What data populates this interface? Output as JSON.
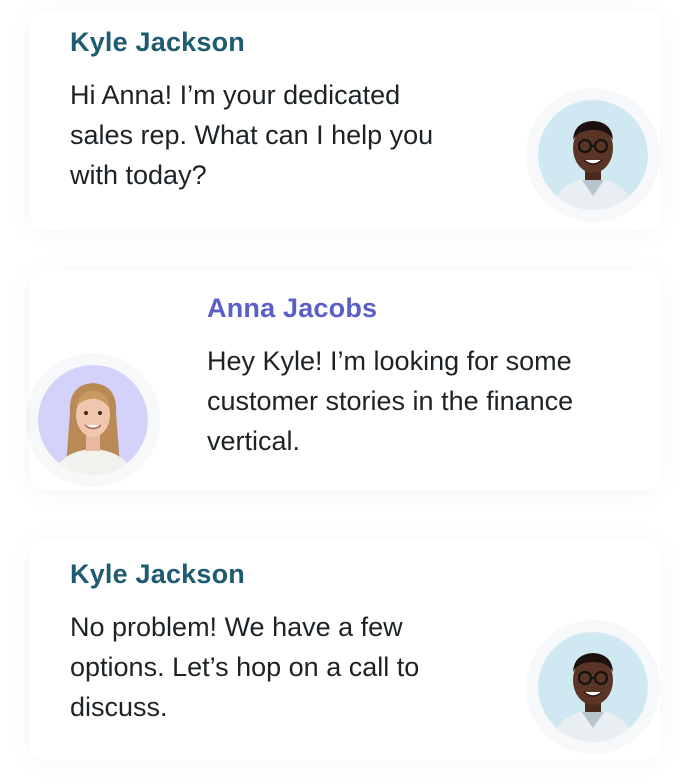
{
  "messages": [
    {
      "sender": "Kyle Jackson",
      "lines": [
        "Hi Anna! I’m your dedicated",
        "sales rep. What can I help you",
        "with today?"
      ],
      "avatar": "man-portrait-avatar",
      "avatar_bg": "#cfe8f2"
    },
    {
      "sender": "Anna Jacobs",
      "lines": [
        "Hey Kyle! I’m looking for some",
        "customer stories in the finance",
        "vertical."
      ],
      "avatar": "woman-portrait-avatar",
      "avatar_bg": "#d4d2fb"
    },
    {
      "sender": "Kyle Jackson",
      "lines": [
        "No problem! We have a few",
        "options. Let’s hop on a call to",
        "discuss."
      ],
      "avatar": "man-portrait-avatar",
      "avatar_bg": "#cfe8f2"
    }
  ],
  "colors": {
    "kyle_name": "#1f5c72",
    "anna_name": "#5b5fc7",
    "message_text": "#1c2226"
  }
}
